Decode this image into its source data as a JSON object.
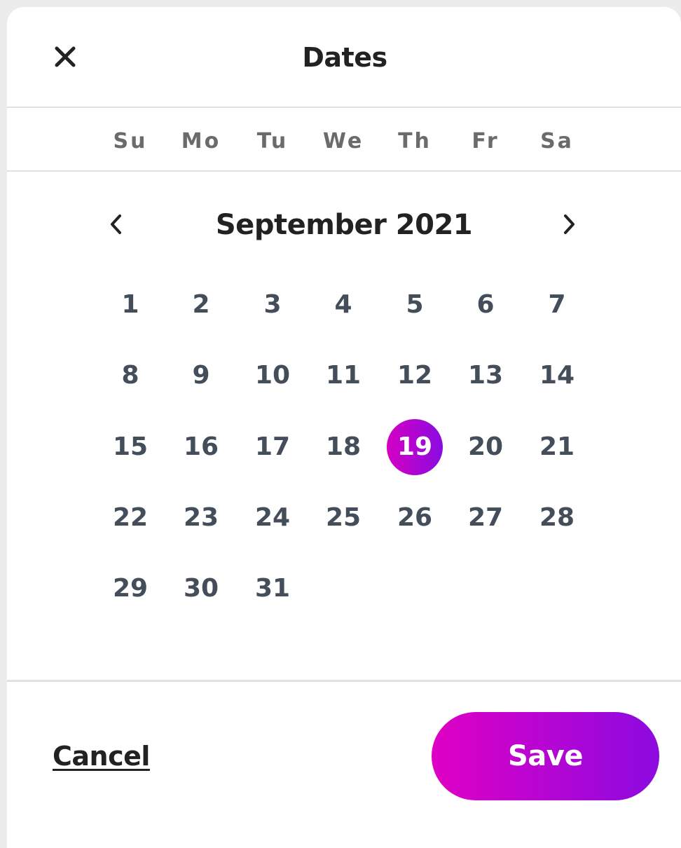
{
  "header": {
    "title": "Dates",
    "close_icon": "close-icon"
  },
  "weekdays": [
    "Su",
    "Mo",
    "Tu",
    "We",
    "Th",
    "Fr",
    "Sa"
  ],
  "calendar": {
    "month_label": "September 2021",
    "prev_icon": "chevron-left-icon",
    "next_icon": "chevron-right-icon",
    "first_weekday_index": 0,
    "days": [
      "1",
      "2",
      "3",
      "4",
      "5",
      "6",
      "7",
      "8",
      "9",
      "10",
      "11",
      "12",
      "13",
      "14",
      "15",
      "16",
      "17",
      "18",
      "19",
      "20",
      "21",
      "22",
      "23",
      "24",
      "25",
      "26",
      "27",
      "28",
      "29",
      "30",
      "31"
    ],
    "selected_day": "19"
  },
  "footer": {
    "cancel_label": "Cancel",
    "save_label": "Save"
  },
  "colors": {
    "accent_start": "#d400c4",
    "accent_end": "#8a0be0",
    "day_text": "#434e5a",
    "weekday_text": "#6b6b6b"
  }
}
